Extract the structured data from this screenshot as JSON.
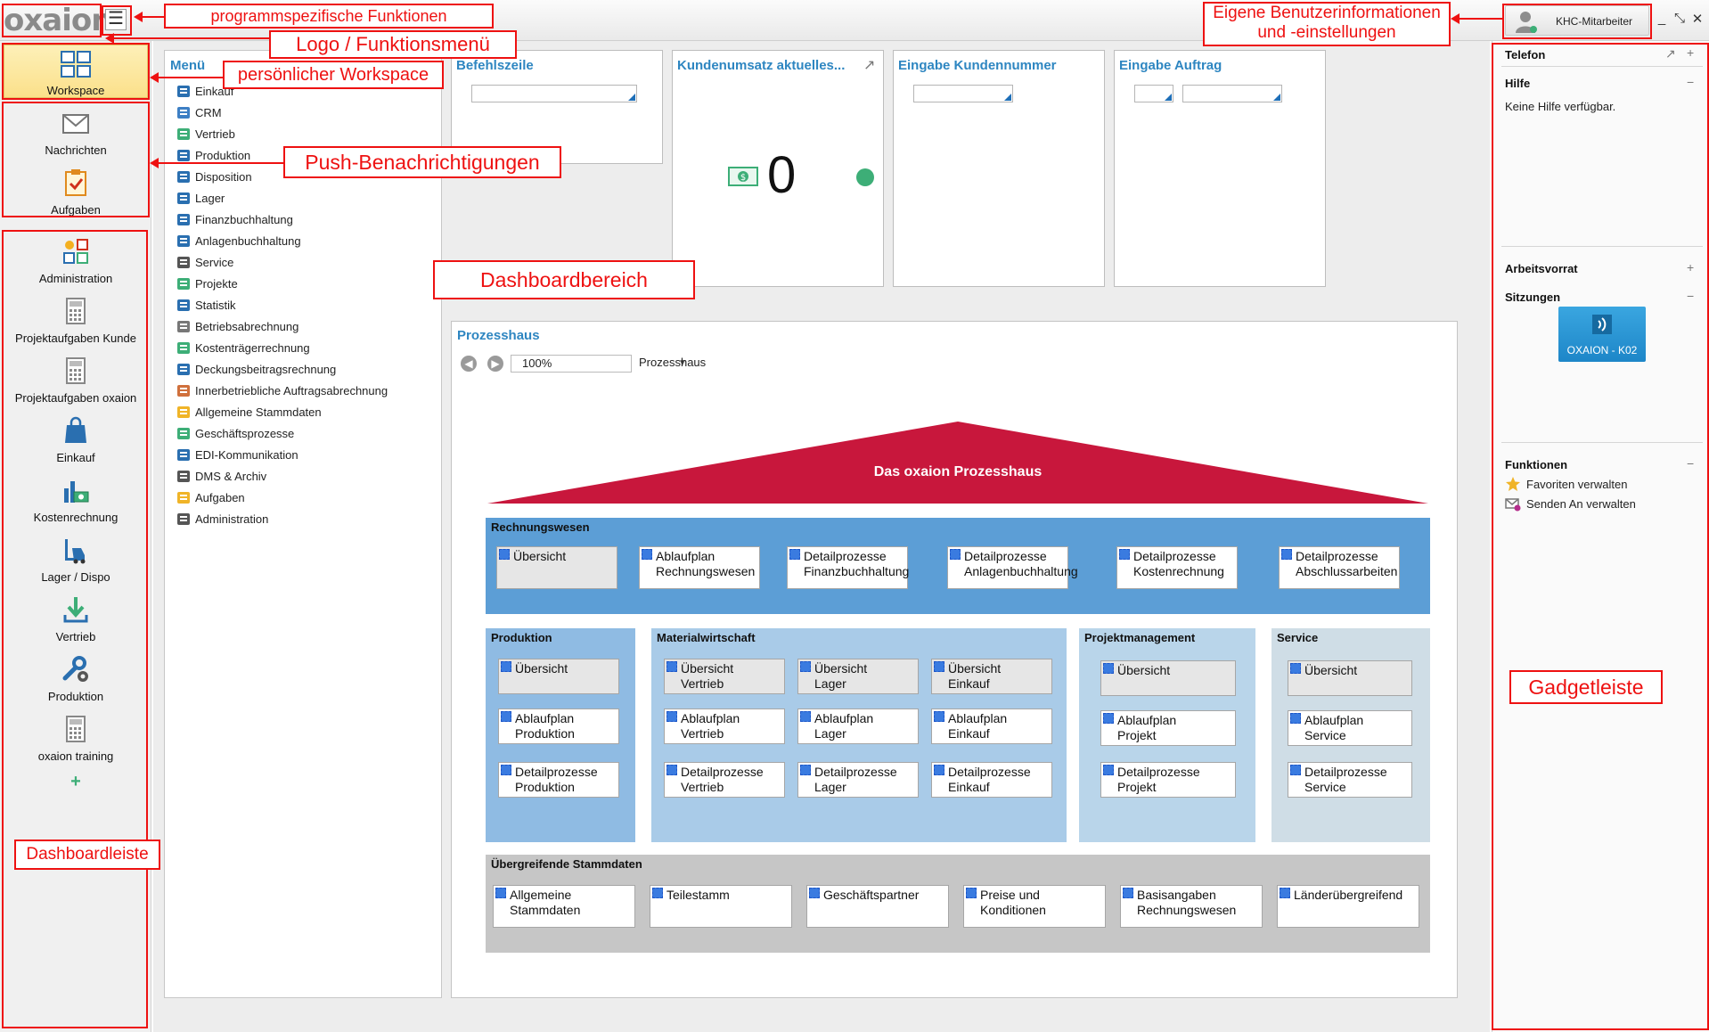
{
  "app": {
    "logo": "oxaion",
    "menu_icon": "hamburger-icon"
  },
  "user": {
    "name": "KHC-Mitarbeiter"
  },
  "window_controls": [
    "_",
    "⤡",
    "✕"
  ],
  "dashboard_bar": {
    "top_items": [
      {
        "label": "Workspace",
        "icon": "workspace-icon"
      }
    ],
    "push_items": [
      {
        "label": "Nachrichten",
        "icon": "envelope-icon"
      },
      {
        "label": "Aufgaben",
        "icon": "clipboard-check-icon"
      }
    ],
    "items": [
      {
        "label": "Administration",
        "icon": "administration-icon"
      },
      {
        "label": "Projektaufgaben Kunde",
        "icon": "calculator-icon"
      },
      {
        "label": "Projektaufgaben oxaion",
        "icon": "calculator-icon"
      },
      {
        "label": "Einkauf",
        "icon": "shopping-bag-icon"
      },
      {
        "label": "Kostenrechnung",
        "icon": "cost-chart-icon"
      },
      {
        "label": "Lager / Dispo",
        "icon": "forklift-icon"
      },
      {
        "label": "Vertrieb",
        "icon": "download-arrow-icon"
      },
      {
        "label": "Produktion",
        "icon": "wrench-gear-icon"
      },
      {
        "label": "oxaion training",
        "icon": "calculator-icon"
      }
    ],
    "add_label": "+"
  },
  "menu": {
    "title": "Menü",
    "items": [
      "Einkauf",
      "CRM",
      "Vertrieb",
      "Produktion",
      "Disposition",
      "Lager",
      "Finanzbuchhaltung",
      "Anlagenbuchhaltung",
      "Service",
      "Projekte",
      "Statistik",
      "Betriebsabrechnung",
      "Kostenträgerrechnung",
      "Deckungsbeitragsrechnung",
      "Innerbetriebliche Auftragsabrechnung",
      "Allgemeine Stammdaten",
      "Geschäftsprozesse",
      "EDI-Kommunikation",
      "DMS & Archiv",
      "Aufgaben",
      "Administration"
    ]
  },
  "tiles": {
    "befehlszeile": {
      "title": "Befehlszeile"
    },
    "kundenumsatz": {
      "title": "Kundenumsatz aktuelles...",
      "value": "0",
      "status_color": "#3dae77"
    },
    "kundennummer": {
      "title": "Eingabe Kundennummer"
    },
    "auftrag": {
      "title": "Eingabe Auftrag"
    }
  },
  "prozesshaus": {
    "title": "Prozesshaus",
    "zoom": "100%",
    "crumb": "Prozesshaus",
    "roof": "Das oxaion Prozesshaus",
    "rechnungswesen": {
      "title": "Rechnungswesen",
      "buttons": [
        [
          "Übersicht"
        ],
        [
          "Ablaufplan",
          "Rechnungswesen"
        ],
        [
          "Detailprozesse",
          "Finanzbuchhaltung"
        ],
        [
          "Detailprozesse",
          "Anlagenbuchhaltung"
        ],
        [
          "Detailprozesse",
          "Kostenrechnung"
        ],
        [
          "Detailprozesse",
          "Abschlussarbeiten"
        ]
      ]
    },
    "produktion": {
      "title": "Produktion",
      "buttons": [
        [
          "Übersicht"
        ],
        [
          "Ablaufplan",
          "Produktion"
        ],
        [
          "Detailprozesse",
          "Produktion"
        ]
      ]
    },
    "materialwirtschaft": {
      "title": "Materialwirtschaft",
      "buttons": [
        [
          "Übersicht",
          "Vertrieb"
        ],
        [
          "Übersicht",
          "Lager"
        ],
        [
          "Übersicht",
          "Einkauf"
        ],
        [
          "Ablaufplan",
          "Vertrieb"
        ],
        [
          "Ablaufplan",
          "Lager"
        ],
        [
          "Ablaufplan",
          "Einkauf"
        ],
        [
          "Detailprozesse",
          "Vertrieb"
        ],
        [
          "Detailprozesse",
          "Lager"
        ],
        [
          "Detailprozesse",
          "Einkauf"
        ]
      ]
    },
    "projektmanagement": {
      "title": "Projektmanagement",
      "buttons": [
        [
          "Übersicht"
        ],
        [
          "Ablaufplan",
          "Projekt"
        ],
        [
          "Detailprozesse",
          "Projekt"
        ]
      ]
    },
    "service": {
      "title": "Service",
      "buttons": [
        [
          "Übersicht"
        ],
        [
          "Ablaufplan",
          "Service"
        ],
        [
          "Detailprozesse",
          "Service"
        ]
      ]
    },
    "stammdaten": {
      "title": "Übergreifende Stammdaten",
      "buttons": [
        [
          "Allgemeine",
          "Stammdaten"
        ],
        [
          "Teilestamm"
        ],
        [
          "Geschäftspartner"
        ],
        [
          "Preise und",
          "Konditionen"
        ],
        [
          "Basisangaben",
          "Rechnungswesen"
        ],
        [
          "Länderübergreifend"
        ]
      ]
    }
  },
  "gadgets": {
    "telefon": "Telefon",
    "hilfe": "Hilfe",
    "hilfe_text": "Keine Hilfe verfügbar.",
    "arbeitsvorrat": "Arbeitsvorrat",
    "sitzungen": "Sitzungen",
    "session_label": "OXAION - K02",
    "funktionen": "Funktionen",
    "fn_items": [
      "Favoriten verwalten",
      "Senden An verwalten"
    ]
  },
  "annotations": {
    "programmspezifisch": "programmspezifische Funktionen",
    "logo": "Logo / Funktionsmenü",
    "workspace": "persönlicher Workspace",
    "push": "Push-Benachrichtigungen",
    "dashboardbereich": "Dashboardbereich",
    "benutzer_l1": "Eigene Benutzerinformationen",
    "benutzer_l2": "und -einstellungen",
    "gadgetleiste": "Gadgetleiste",
    "dashboardleiste": "Dashboardleiste"
  },
  "colors": {
    "accent": "#2e86c1",
    "roof": "#c8173c",
    "annotation": "#e11111"
  }
}
